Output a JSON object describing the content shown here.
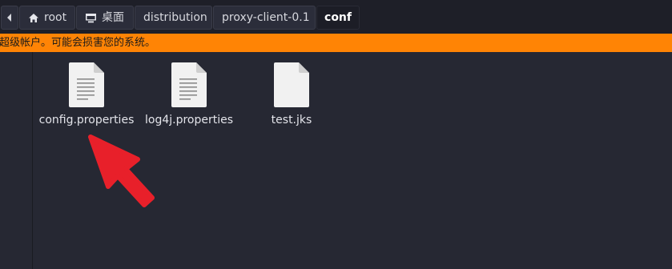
{
  "pathbar": {
    "items": [
      {
        "label": "",
        "icon": "left-arrow-icon"
      },
      {
        "label": "root",
        "icon": "home-icon"
      },
      {
        "label": "桌面",
        "icon": "desktop-icon"
      },
      {
        "label": "distribution"
      },
      {
        "label": "proxy-client-0.1"
      },
      {
        "label": "conf",
        "active": true
      }
    ]
  },
  "warning": {
    "text": "超级帐户。可能会损害您的系统。",
    "color": "#ff8405"
  },
  "files": [
    {
      "name": "config.properties",
      "icon": "text-file-icon"
    },
    {
      "name": "log4j.properties",
      "icon": "text-file-icon"
    },
    {
      "name": "test.jks",
      "icon": "blank-file-icon"
    }
  ],
  "annotation": {
    "icon": "red-arrow-icon",
    "color": "#e8202a"
  }
}
